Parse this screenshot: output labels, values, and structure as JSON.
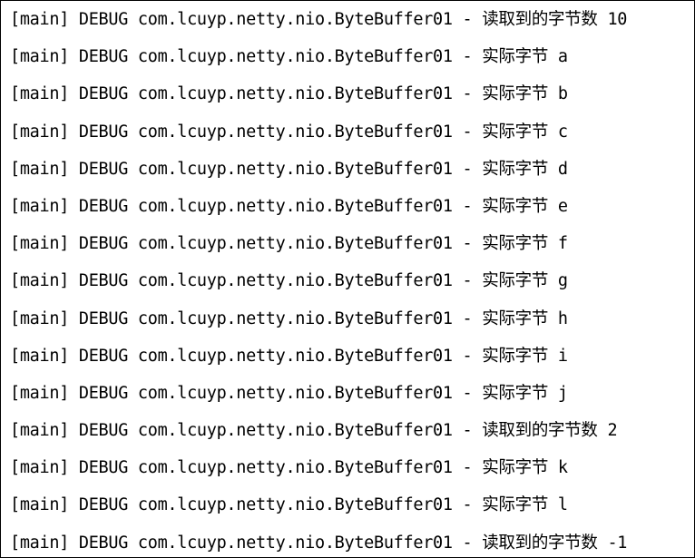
{
  "console": {
    "lines": [
      "[main] DEBUG com.lcuyp.netty.nio.ByteBuffer01 - 读取到的字节数 10",
      "[main] DEBUG com.lcuyp.netty.nio.ByteBuffer01 - 实际字节 a",
      "[main] DEBUG com.lcuyp.netty.nio.ByteBuffer01 - 实际字节 b",
      "[main] DEBUG com.lcuyp.netty.nio.ByteBuffer01 - 实际字节 c",
      "[main] DEBUG com.lcuyp.netty.nio.ByteBuffer01 - 实际字节 d",
      "[main] DEBUG com.lcuyp.netty.nio.ByteBuffer01 - 实际字节 e",
      "[main] DEBUG com.lcuyp.netty.nio.ByteBuffer01 - 实际字节 f",
      "[main] DEBUG com.lcuyp.netty.nio.ByteBuffer01 - 实际字节 g",
      "[main] DEBUG com.lcuyp.netty.nio.ByteBuffer01 - 实际字节 h",
      "[main] DEBUG com.lcuyp.netty.nio.ByteBuffer01 - 实际字节 i",
      "[main] DEBUG com.lcuyp.netty.nio.ByteBuffer01 - 实际字节 j",
      "[main] DEBUG com.lcuyp.netty.nio.ByteBuffer01 - 读取到的字节数 2",
      "[main] DEBUG com.lcuyp.netty.nio.ByteBuffer01 - 实际字节 k",
      "[main] DEBUG com.lcuyp.netty.nio.ByteBuffer01 - 实际字节 l",
      "[main] DEBUG com.lcuyp.netty.nio.ByteBuffer01 - 读取到的字节数 -1"
    ]
  }
}
